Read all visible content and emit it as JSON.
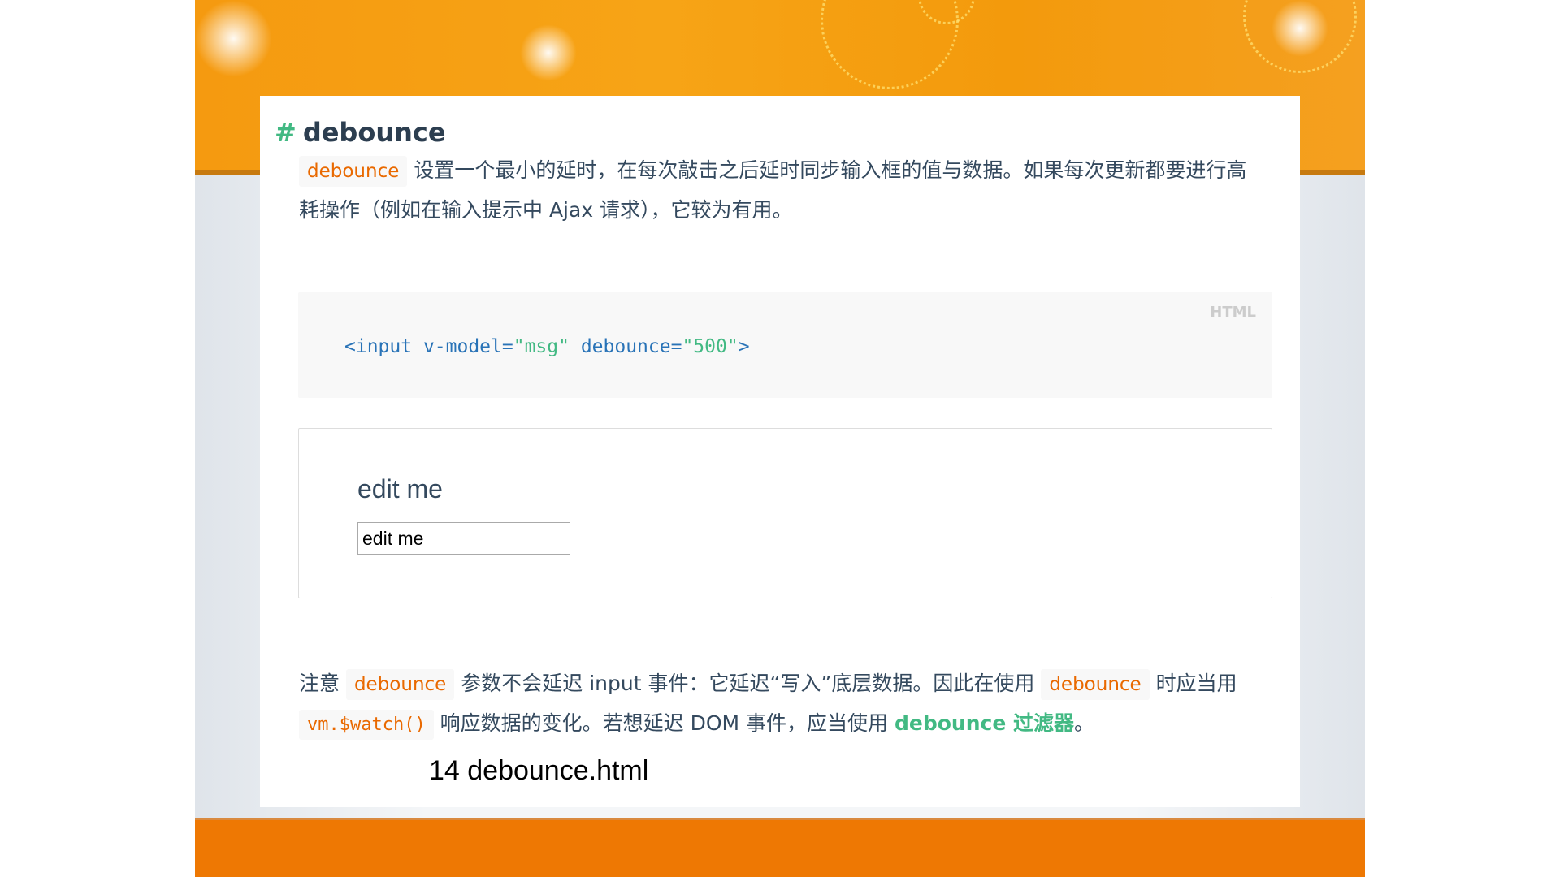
{
  "heading": {
    "hash": "#",
    "title": "debounce"
  },
  "intro": {
    "code": "debounce",
    "text": "设置一个最小的延时，在每次敲击之后延时同步输入框的值与数据。如果每次更新都要进行高耗操作（例如在输入提示中 Ajax 请求），它较为有用。"
  },
  "code_block": {
    "lang": "HTML",
    "tag_open": "<input ",
    "attr1": "v-model=",
    "val1": "\"msg\"",
    "attr2": " debounce=",
    "val2": "\"500\"",
    "tag_close": ">"
  },
  "demo": {
    "label": "edit me",
    "input_value": "edit me"
  },
  "note": {
    "t1": "注意 ",
    "code1": "debounce",
    "t2": " 参数不会延迟 input 事件：它延迟“写入”底层数据。因此在使用 ",
    "code2": "debounce",
    "t3": " 时应当用 ",
    "code3": "vm.$watch()",
    "t4": " 响应数据的变化。若想延迟 DOM 事件，应当使用 ",
    "link": "debounce 过滤器",
    "t5": "。"
  },
  "caption": "14 debounce.html",
  "colors": {
    "accent": "#42b983",
    "code": "#e96900",
    "orange": "#ee7803"
  }
}
